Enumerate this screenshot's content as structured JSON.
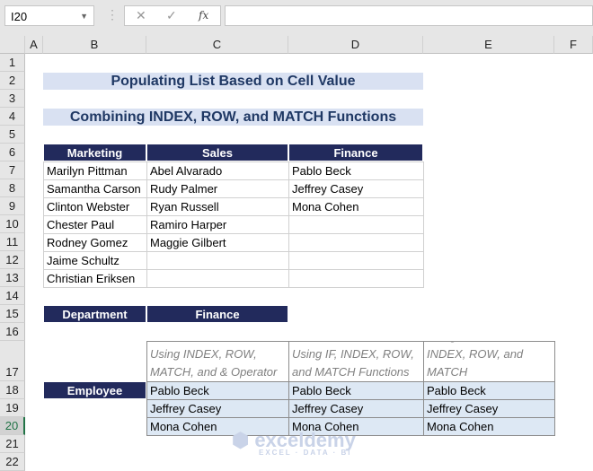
{
  "name_box": "I20",
  "formula_bar": {
    "cancel_icon": "✕",
    "enter_icon": "✓",
    "fx_label": "fx",
    "value": ""
  },
  "columns": [
    "A",
    "B",
    "C",
    "D",
    "E",
    "F"
  ],
  "rows": [
    "1",
    "2",
    "3",
    "4",
    "5",
    "6",
    "7",
    "8",
    "9",
    "10",
    "11",
    "12",
    "13",
    "14",
    "15",
    "16",
    "17",
    "18",
    "19",
    "20",
    "21",
    "22"
  ],
  "title1": "Populating List Based on Cell Value",
  "title2": "Combining INDEX, ROW, and MATCH Functions",
  "dept_table": {
    "headers": [
      "Marketing",
      "Sales",
      "Finance"
    ],
    "marketing": [
      "Marilyn Pittman",
      "Samantha Carson",
      "Clinton Webster",
      "Chester Paul",
      "Rodney Gomez",
      "Jaime Schultz",
      "Christian Eriksen"
    ],
    "sales": [
      "Abel Alvarado",
      "Rudy Palmer",
      "Ryan Russell",
      "Ramiro Harper",
      "Maggie Gilbert",
      "",
      ""
    ],
    "finance": [
      "Pablo Beck",
      "Jeffrey Casey",
      "Mona Cohen",
      "",
      "",
      "",
      ""
    ]
  },
  "department_label": "Department",
  "department_value": "Finance",
  "employee_label": "Employee",
  "result_headers": [
    "Using INDEX, ROW, MATCH, and & Operator",
    "Using IF, INDEX, ROW, and MATCH Functions",
    "Using IFERROR, INDEX, ROW, and MATCH"
  ],
  "results": [
    [
      "Pablo Beck",
      "Jeffrey Casey",
      "Mona Cohen"
    ],
    [
      "Pablo Beck",
      "Jeffrey Casey",
      "Mona Cohen"
    ],
    [
      "Pablo Beck",
      "Jeffrey Casey",
      "Mona Cohen"
    ]
  ],
  "watermark": {
    "name": "exceldemy",
    "tagline": "EXCEL · DATA · BI"
  }
}
